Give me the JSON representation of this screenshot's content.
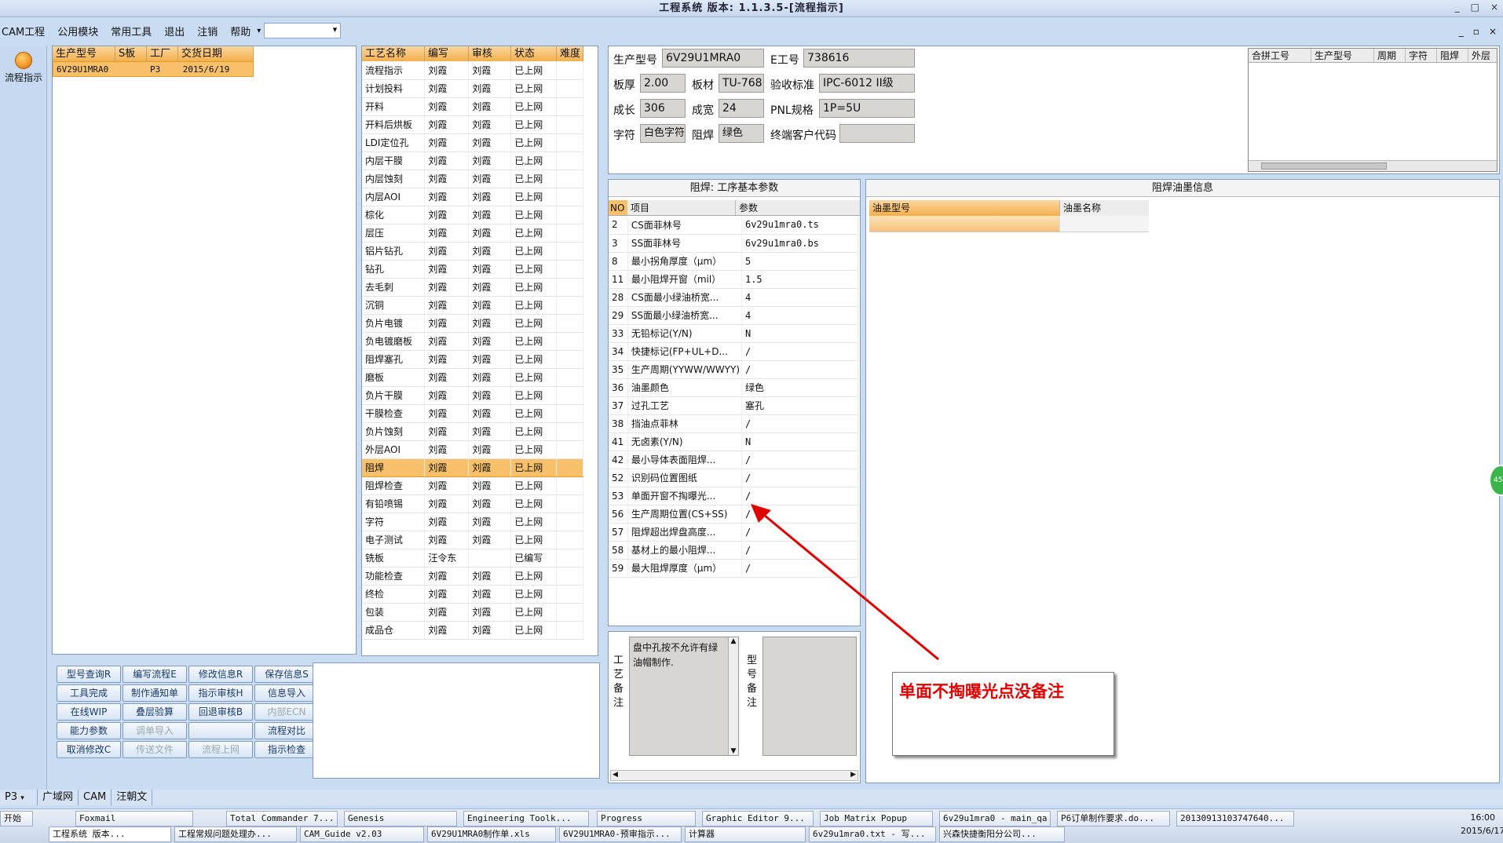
{
  "window": {
    "title": "工程系统 版本: 1.1.3.5-[流程指示]",
    "min": "_",
    "max": "□",
    "close": "×"
  },
  "menu": {
    "items": [
      "CAM工程",
      "公用模块",
      "常用工具",
      "退出",
      "注销",
      "帮助"
    ],
    "combo_value": ""
  },
  "mdi": {
    "min": "_",
    "restore": "▫",
    "close": "×"
  },
  "leftnav": {
    "label": "流程指示"
  },
  "orders": {
    "headers": [
      "生产型号",
      "S板",
      "工厂",
      "交货日期"
    ],
    "rows": [
      [
        "6V29U1MRA0",
        "",
        "P3",
        "2015/6/19"
      ]
    ]
  },
  "process": {
    "headers": [
      "工艺名称",
      "编写",
      "审核",
      "状态",
      "难度"
    ],
    "rows": [
      [
        "流程指示",
        "刘霞",
        "刘霞",
        "已上网",
        ""
      ],
      [
        "计划投料",
        "刘霞",
        "刘霞",
        "已上网",
        ""
      ],
      [
        "开料",
        "刘霞",
        "刘霞",
        "已上网",
        ""
      ],
      [
        "开料后烘板",
        "刘霞",
        "刘霞",
        "已上网",
        ""
      ],
      [
        "LDI定位孔",
        "刘霞",
        "刘霞",
        "已上网",
        ""
      ],
      [
        "内层干膜",
        "刘霞",
        "刘霞",
        "已上网",
        ""
      ],
      [
        "内层蚀刻",
        "刘霞",
        "刘霞",
        "已上网",
        ""
      ],
      [
        "内层AOI",
        "刘霞",
        "刘霞",
        "已上网",
        ""
      ],
      [
        "棕化",
        "刘霞",
        "刘霞",
        "已上网",
        ""
      ],
      [
        "层压",
        "刘霞",
        "刘霞",
        "已上网",
        ""
      ],
      [
        "铝片钻孔",
        "刘霞",
        "刘霞",
        "已上网",
        ""
      ],
      [
        "钻孔",
        "刘霞",
        "刘霞",
        "已上网",
        ""
      ],
      [
        "去毛刺",
        "刘霞",
        "刘霞",
        "已上网",
        ""
      ],
      [
        "沉铜",
        "刘霞",
        "刘霞",
        "已上网",
        ""
      ],
      [
        "负片电镀",
        "刘霞",
        "刘霞",
        "已上网",
        ""
      ],
      [
        "负电镀磨板",
        "刘霞",
        "刘霞",
        "已上网",
        ""
      ],
      [
        "阻焊塞孔",
        "刘霞",
        "刘霞",
        "已上网",
        ""
      ],
      [
        "磨板",
        "刘霞",
        "刘霞",
        "已上网",
        ""
      ],
      [
        "负片干膜",
        "刘霞",
        "刘霞",
        "已上网",
        ""
      ],
      [
        "干膜检查",
        "刘霞",
        "刘霞",
        "已上网",
        ""
      ],
      [
        "负片蚀刻",
        "刘霞",
        "刘霞",
        "已上网",
        ""
      ],
      [
        "外层AOI",
        "刘霞",
        "刘霞",
        "已上网",
        ""
      ],
      [
        "阻焊",
        "刘霞",
        "刘霞",
        "已上网",
        ""
      ],
      [
        "阻焊检查",
        "刘霞",
        "刘霞",
        "已上网",
        ""
      ],
      [
        "有铅喷锡",
        "刘霞",
        "刘霞",
        "已上网",
        ""
      ],
      [
        "字符",
        "刘霞",
        "刘霞",
        "已上网",
        ""
      ],
      [
        "电子测试",
        "刘霞",
        "刘霞",
        "已上网",
        ""
      ],
      [
        "铣板",
        "汪令东",
        "",
        "已编写",
        ""
      ],
      [
        "功能检查",
        "刘霞",
        "刘霞",
        "已上网",
        ""
      ],
      [
        "终检",
        "刘霞",
        "刘霞",
        "已上网",
        ""
      ],
      [
        "包装",
        "刘霞",
        "刘霞",
        "已上网",
        ""
      ],
      [
        "成品仓",
        "刘霞",
        "刘霞",
        "已上网",
        ""
      ]
    ],
    "selected_index": 22
  },
  "buttons": [
    [
      "型号查询R",
      "编写流程E",
      "修改信息R",
      "保存信息S"
    ],
    [
      "工具完成",
      "制作通知单",
      "指示审核H",
      "信息导入"
    ],
    [
      "在线WIP",
      "叠层验算",
      "回退审核B",
      "内部ECN"
    ],
    [
      "能力参数",
      "调单导入",
      "",
      "流程对比"
    ],
    [
      "取消修改C",
      "传送文件",
      "流程上网",
      "指示检查"
    ]
  ],
  "buttons_disabled": [
    "内部ECN",
    "调单导入",
    "传送文件",
    "流程上网"
  ],
  "info": {
    "prod_model_label": "生产型号",
    "prod_model": "6V29U1MRA0",
    "e_no_label": "E工号",
    "e_no": "738616",
    "thickness_label": "板厚",
    "thickness": "2.00",
    "material_label": "板材",
    "material": "TU-768",
    "standard_label": "验收标准",
    "standard": "IPC-6012 II级",
    "length_label": "成长",
    "length": "306",
    "width_label": "成宽",
    "width": "24",
    "pnl_label": "PNL规格",
    "pnl": "1P=5U",
    "char_label": "字符",
    "char": "白色字符",
    "mask_label": "阻焊",
    "mask": "绿色",
    "client_label": "终端客户代码",
    "client": ""
  },
  "combo_table": {
    "headers": [
      "合拼工号",
      "生产型号",
      "周期",
      "字符",
      "阻焊",
      "外层"
    ]
  },
  "params": {
    "title": "阻焊: 工序基本参数",
    "headers": [
      "NO",
      "项目",
      "参数"
    ],
    "rows": [
      [
        "2",
        "CS面菲林号",
        "6v29u1mra0.ts"
      ],
      [
        "3",
        "SS面菲林号",
        "6v29u1mra0.bs"
      ],
      [
        "8",
        "最小拐角厚度（μm）",
        "5"
      ],
      [
        "11",
        "最小阻焊开窗（mil）",
        "1.5"
      ],
      [
        "28",
        "CS面最小绿油桥宽...",
        "4"
      ],
      [
        "29",
        "SS面最小绿油桥宽...",
        "4"
      ],
      [
        "33",
        "无铅标记(Y/N)",
        "N"
      ],
      [
        "34",
        "快捷标记(FP+UL+D...",
        "/"
      ],
      [
        "35",
        "生产周期(YYWW/WWYY)",
        "/"
      ],
      [
        "36",
        "油墨颜色",
        "绿色"
      ],
      [
        "37",
        "过孔工艺",
        "塞孔"
      ],
      [
        "38",
        "挡油点菲林",
        "/"
      ],
      [
        "41",
        "无卤素(Y/N)",
        "N"
      ],
      [
        "42",
        "最小导体表面阻焊...",
        "/"
      ],
      [
        "52",
        "识别码位置图纸",
        "/"
      ],
      [
        "53",
        "单面开窗不掏曝光...",
        "/"
      ],
      [
        "56",
        "生产周期位置(CS+SS)",
        "/"
      ],
      [
        "57",
        "阻焊超出焊盘高度...",
        "/"
      ],
      [
        "58",
        "基材上的最小阻焊...",
        "/"
      ],
      [
        "59",
        "最大阻焊厚度（μm）",
        "/"
      ]
    ]
  },
  "ink": {
    "title": "阻焊油墨信息",
    "headers": [
      "油墨型号",
      "油墨名称"
    ]
  },
  "process_note": {
    "label": "工艺备注",
    "text": "盘中孔按不允许有绿油帽制作."
  },
  "model_note": {
    "label": "型号备注",
    "text": ""
  },
  "callout": {
    "text": "单面不掏曝光点没备注",
    "color": "#e00000"
  },
  "bottom_tabs": [
    "P3",
    "广域网",
    "CAM",
    "汪朝文"
  ],
  "taskbar": {
    "start": "开始",
    "row1": [
      "Foxmail",
      "Total Commander 7...",
      "Genesis",
      "Engineering Toolk...",
      "Progress",
      "Graphic Editor 9...",
      "Job Matrix Popup",
      "6v29u1mra0 - main_qa",
      "P6订单制作要求.do...",
      "20130913103747640..."
    ],
    "row2": [
      "工程系统 版本...",
      "工程常规问题处理办...",
      "CAM_Guide v2.03",
      "6V29U1MRA0制作单.xls",
      "6V29U1MRA0-预审指示...",
      "计算器",
      "6v29u1mra0.txt - 写...",
      "兴森快捷衡阳分公司..."
    ],
    "time": "16:00",
    "date": "2015/6/17"
  }
}
